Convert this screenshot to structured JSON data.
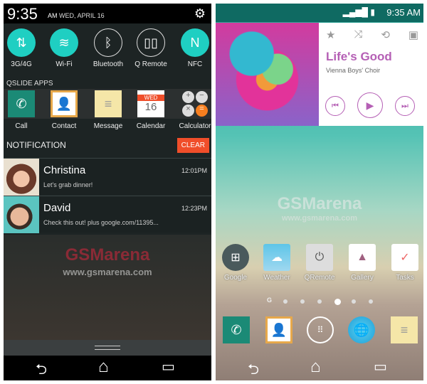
{
  "left": {
    "status": {
      "time": "9:35",
      "ampm": "AM",
      "date": "WED, APRIL 16"
    },
    "toggles": [
      {
        "label": "3G/4G",
        "icon": "data-arrows-icon",
        "glyph": "⇅",
        "on": true
      },
      {
        "label": "Wi-Fi",
        "icon": "wifi-icon",
        "glyph": "≋",
        "on": true
      },
      {
        "label": "Bluetooth",
        "icon": "bluetooth-icon",
        "glyph": "ᛒ",
        "on": false
      },
      {
        "label": "Q Remote",
        "icon": "remote-icon",
        "glyph": "▯▯",
        "on": false
      },
      {
        "label": "NFC",
        "icon": "nfc-icon",
        "glyph": "N",
        "on": true
      }
    ],
    "qslide_title": "QSLIDE APPS",
    "qslide_apps": [
      {
        "label": "Call",
        "glyph": "✆"
      },
      {
        "label": "Contact",
        "glyph": "👤"
      },
      {
        "label": "Message",
        "glyph": "≡"
      },
      {
        "label": "Calendar",
        "day": "WED",
        "date": "16"
      },
      {
        "label": "Calculator",
        "glyph": "±"
      }
    ],
    "notification_title": "NOTIFICATION",
    "clear_label": "CLEAR",
    "notifications": [
      {
        "name": "Christina",
        "time": "12:01PM",
        "message": "Let's grab dinner!"
      },
      {
        "name": "David",
        "time": "12:23PM",
        "message": "Check this out! plus google.com/11395..."
      }
    ],
    "watermark": {
      "logo": "GSMarena",
      "url": "www.gsmarena.com"
    }
  },
  "right": {
    "status": {
      "time": "9:35 AM"
    },
    "music": {
      "title": "Life's Good",
      "artist": "Vienna Boys' Choir",
      "accent": "#b55fb5"
    },
    "watermark": {
      "logo": "GSMarena",
      "url": "www.gsmarena.com"
    },
    "apps": [
      {
        "label": "Google"
      },
      {
        "label": "Weather"
      },
      {
        "label": "QRemote"
      },
      {
        "label": "Gallery"
      },
      {
        "label": "Tasks"
      }
    ],
    "page_indicator": {
      "first": "G",
      "count": 6,
      "active": 4
    }
  },
  "nav": {
    "back": "⮌",
    "home": "⌂",
    "recent": "▭"
  }
}
